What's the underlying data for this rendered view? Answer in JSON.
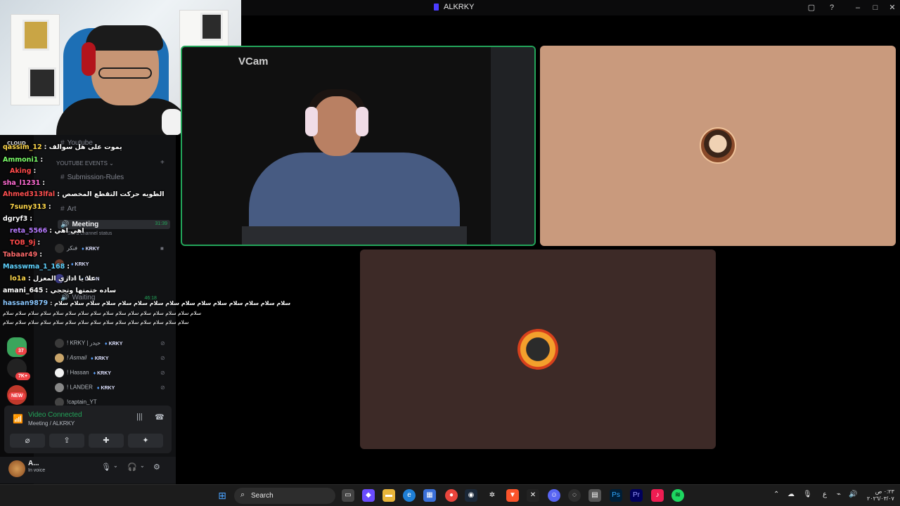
{
  "window": {
    "title": "ALKRKY"
  },
  "webcam_overlay": {
    "label": ""
  },
  "sidebar": {
    "channels": [
      {
        "name": "Youtube"
      },
      {
        "name": "YOUTUBE EVENTS",
        "category": true
      },
      {
        "name": "Submission-Rules"
      },
      {
        "name": "Art"
      },
      {
        "name": "Meeting",
        "time": "31:39",
        "status": "Set a channel status"
      },
      {
        "name": "Waiting",
        "time": "46:18"
      }
    ],
    "voice_users": [
      {
        "name": "فنكر",
        "tag": "KRKY"
      },
      {
        "name": "",
        "tag": "KRKY"
      },
      {
        "name": "Kun",
        "tag": "DNGN"
      },
      {
        "name": "! KRKY | حيدر",
        "tag": "KRKY"
      },
      {
        "name": "! Asmail",
        "tag": "KRKY"
      },
      {
        "name": "! Hassan",
        "tag": "KRKY"
      },
      {
        "name": "! LANDER",
        "tag": "KRKY"
      },
      {
        "name": "!captain_YT",
        "tag": ""
      }
    ],
    "badges": [
      "37",
      "7K+",
      "NEW"
    ],
    "cloud_label": "CLOUD"
  },
  "chat": [
    {
      "user": "qassim_12",
      "msg": "يموت على هل سوالف",
      "color": "#ffd84a"
    },
    {
      "user": "Ammoni1",
      "msg": "",
      "color": "#7dff6a"
    },
    {
      "user": "Aking",
      "msg": "",
      "color": "#ff4a4a"
    },
    {
      "user": "sha_l1231",
      "msg": "",
      "color": "#ff6bd3"
    },
    {
      "user": "Ahmed313lfal",
      "msg": "الطويه حركت التقطع المخصص",
      "color": "#ff5050"
    },
    {
      "user": "7suny313",
      "msg": "",
      "color": "#ffd84a"
    },
    {
      "user": "dgryf3",
      "msg": "",
      "color": "#ffffff"
    },
    {
      "user": "reta_5566",
      "msg": "اهي اهي",
      "color": "#b77bff"
    },
    {
      "user": "TOB_9j",
      "msg": "",
      "color": "#ff4a4a"
    },
    {
      "user": "Tabaar49",
      "msg": "",
      "color": "#ff6b6b"
    },
    {
      "user": "Masswma_1_168",
      "msg": "",
      "color": "#5fd3ff"
    },
    {
      "user": "lo1a",
      "msg": "علا يا اداري المعزل",
      "color": "#ffd84a"
    },
    {
      "user": "amani_645",
      "msg": "ساده ختمتها وتحجي",
      "color": "#ffffff"
    },
    {
      "user": "hassan9879",
      "msg": "سلام سلام سلام سلام سلام سلام سلام سلام سلام سلام سلام سلام سلام سلام سلام",
      "color": "#8ac7ff"
    }
  ],
  "chat_spam": [
    "سلام سلام سلام سلام سلام سلام سلام سلام سلام سلام سلام سلام سلام سلام سلام سلام",
    "سلام سلام سلام سلام سلام سلام سلام سلام سلام سلام سلام سلام سلام سلام سلام"
  ],
  "voice_panel": {
    "status": "Video Connected",
    "channel": "Meeting / ALKRKY"
  },
  "user_panel": {
    "name": "A...",
    "sub": "In voice"
  },
  "tiles": {
    "vcam_label": "VCam"
  },
  "taskbar": {
    "search_placeholder": "Search",
    "clock_time": "٠:٢٣ ص",
    "clock_date": "٢٠٢٦/٠٣/٠٧",
    "lang": "ع"
  },
  "colors": {
    "accent_green": "#23a55a",
    "discord_bg": "#111214",
    "tile_peach": "#c99a7d",
    "tile_brown": "#3d2a27"
  }
}
